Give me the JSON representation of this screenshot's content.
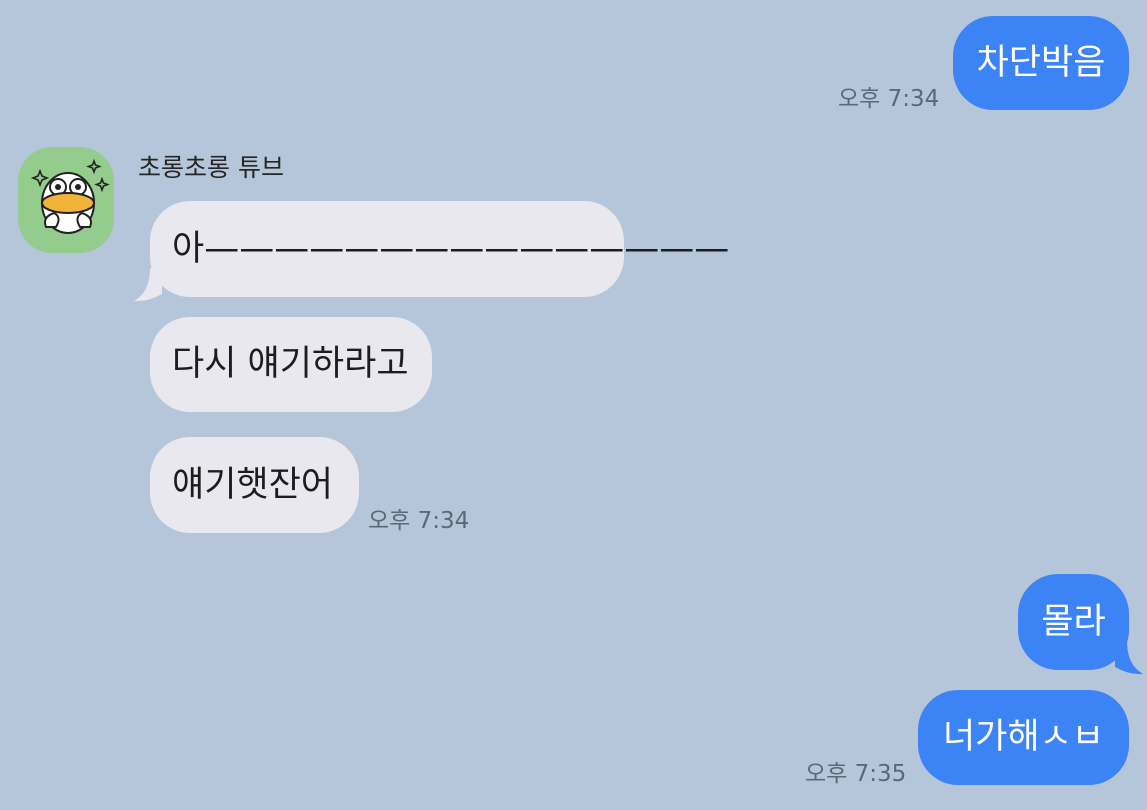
{
  "contact": {
    "name": "초롱초롱 튜브",
    "avatar_icon": "tube-duck-sticker-avatar"
  },
  "colors": {
    "background": "#b6c6da",
    "outgoing": "#3c84f5",
    "incoming": "#e9e8ee"
  },
  "messages": [
    {
      "direction": "out",
      "text": "차단박음",
      "time": "오후 7:34"
    },
    {
      "direction": "in",
      "text": "아———————————————"
    },
    {
      "direction": "in",
      "text": "다시 얘기하라고"
    },
    {
      "direction": "in",
      "text": "얘기햇잔어",
      "time": "오후 7:34"
    },
    {
      "direction": "out",
      "text": "몰라"
    },
    {
      "direction": "out",
      "text": "너가해ㅅㅂ",
      "time": "오후 7:35"
    }
  ]
}
